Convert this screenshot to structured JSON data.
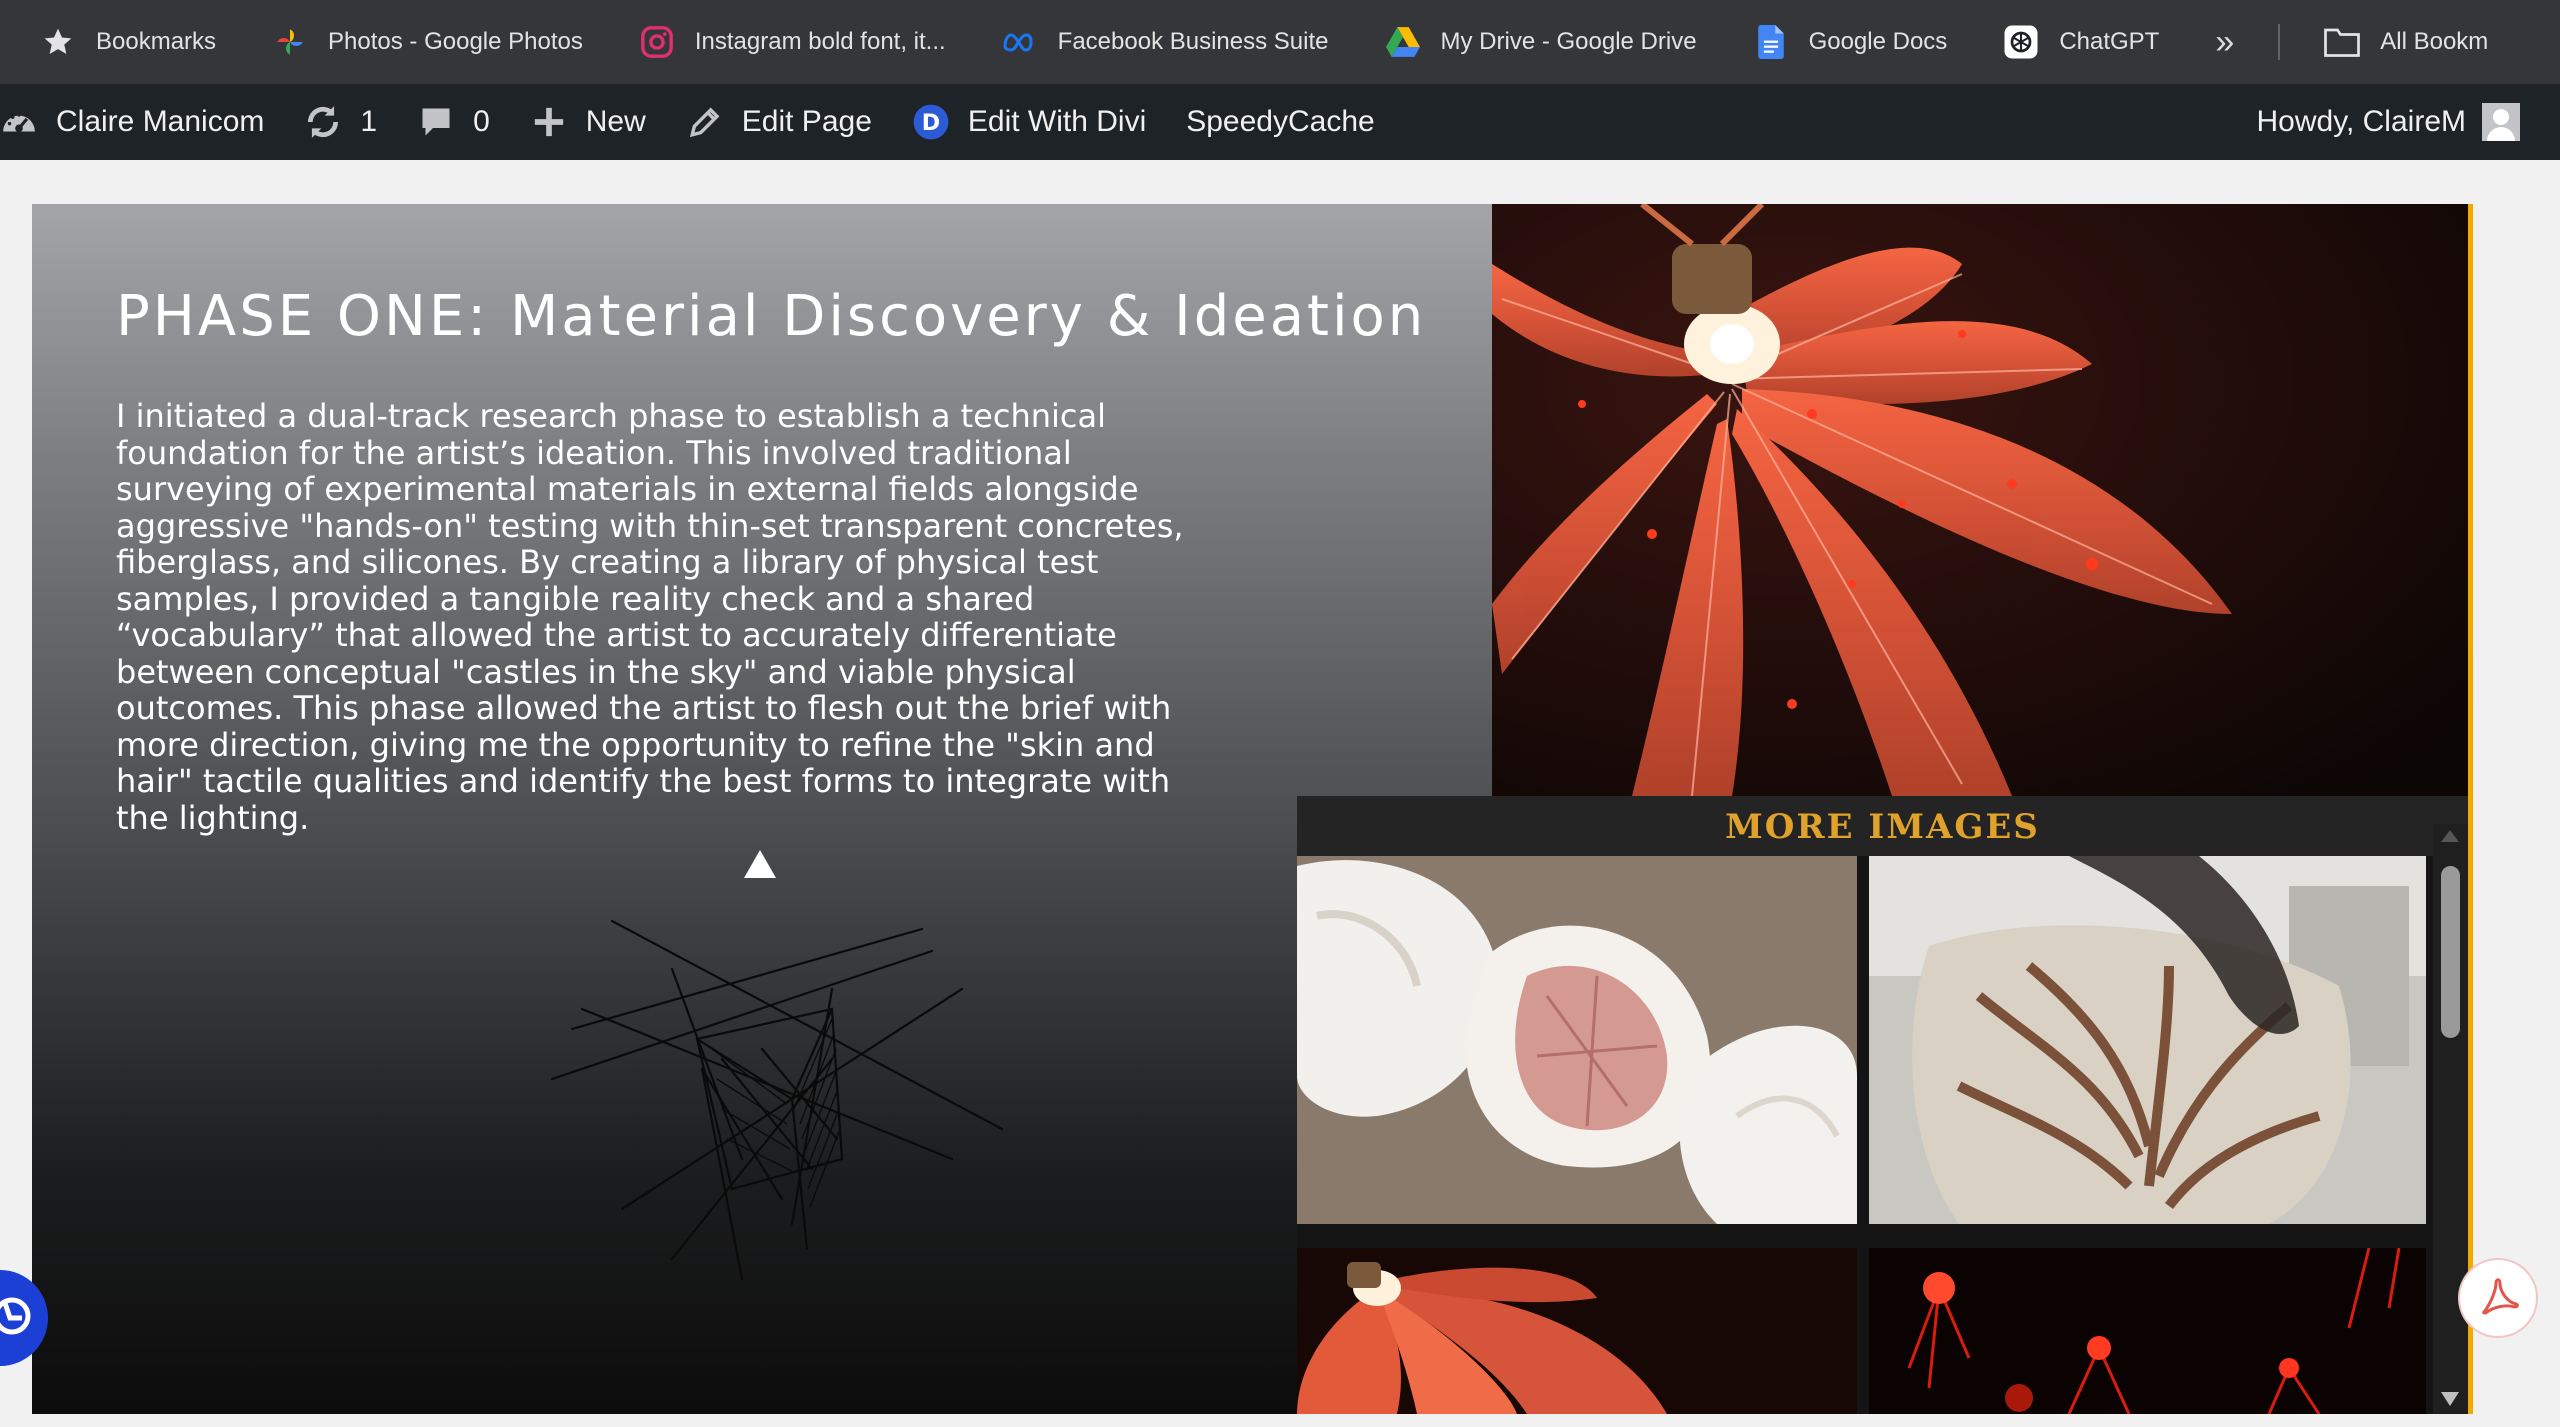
{
  "bookmarks": {
    "items": [
      {
        "label": "Bookmarks",
        "icon": "star-icon"
      },
      {
        "label": "Photos - Google Photos",
        "icon": "google-photos-icon"
      },
      {
        "label": "Instagram bold font, it...",
        "icon": "instagram-icon"
      },
      {
        "label": "Facebook Business Suite",
        "icon": "meta-icon"
      },
      {
        "label": "My Drive - Google Drive",
        "icon": "google-drive-icon"
      },
      {
        "label": "Google Docs",
        "icon": "google-docs-icon"
      },
      {
        "label": "ChatGPT",
        "icon": "chatgpt-icon"
      }
    ],
    "overflow_icon": "chevron-double-right-icon",
    "all_bookmarks_label": "All Bookm"
  },
  "adminbar": {
    "site_name": "Claire Manicom",
    "updates_count": "1",
    "comments_count": "0",
    "new_label": "New",
    "edit_page_label": "Edit Page",
    "divi_label": "Edit With Divi",
    "speedycache_label": "SpeedyCache",
    "howdy_label": "Howdy, ClaireM"
  },
  "content": {
    "title": "PHASE ONE: Material Discovery & Ideation",
    "body": "I initiated a dual-track research phase to establish a technical foundation for the artist’s ideation. This involved traditional surveying of experimental materials in external fields alongside aggressive \"hands-on\" testing with thin-set transparent concretes, fiberglass, and silicones. By creating a library of physical test samples, I provided a tangible reality check and a shared “vocabulary” that allowed the artist to accurately differentiate between conceptual \"castles in the sky\" and viable physical outcomes. This phase allowed the artist to flesh out the brief with more direction, giving me the opportunity to refine the \"skin and hair\" tactile qualities and identify the best forms to integrate with the lighting.",
    "more_images_title": "MORE IMAGES"
  },
  "colors": {
    "accent_gold": "#f2a900",
    "more_images_title": "#e0a22a",
    "adminbar_bg": "#1d2327",
    "bookmarks_bg": "#35363a",
    "divi_blue": "#2b5cd6"
  }
}
